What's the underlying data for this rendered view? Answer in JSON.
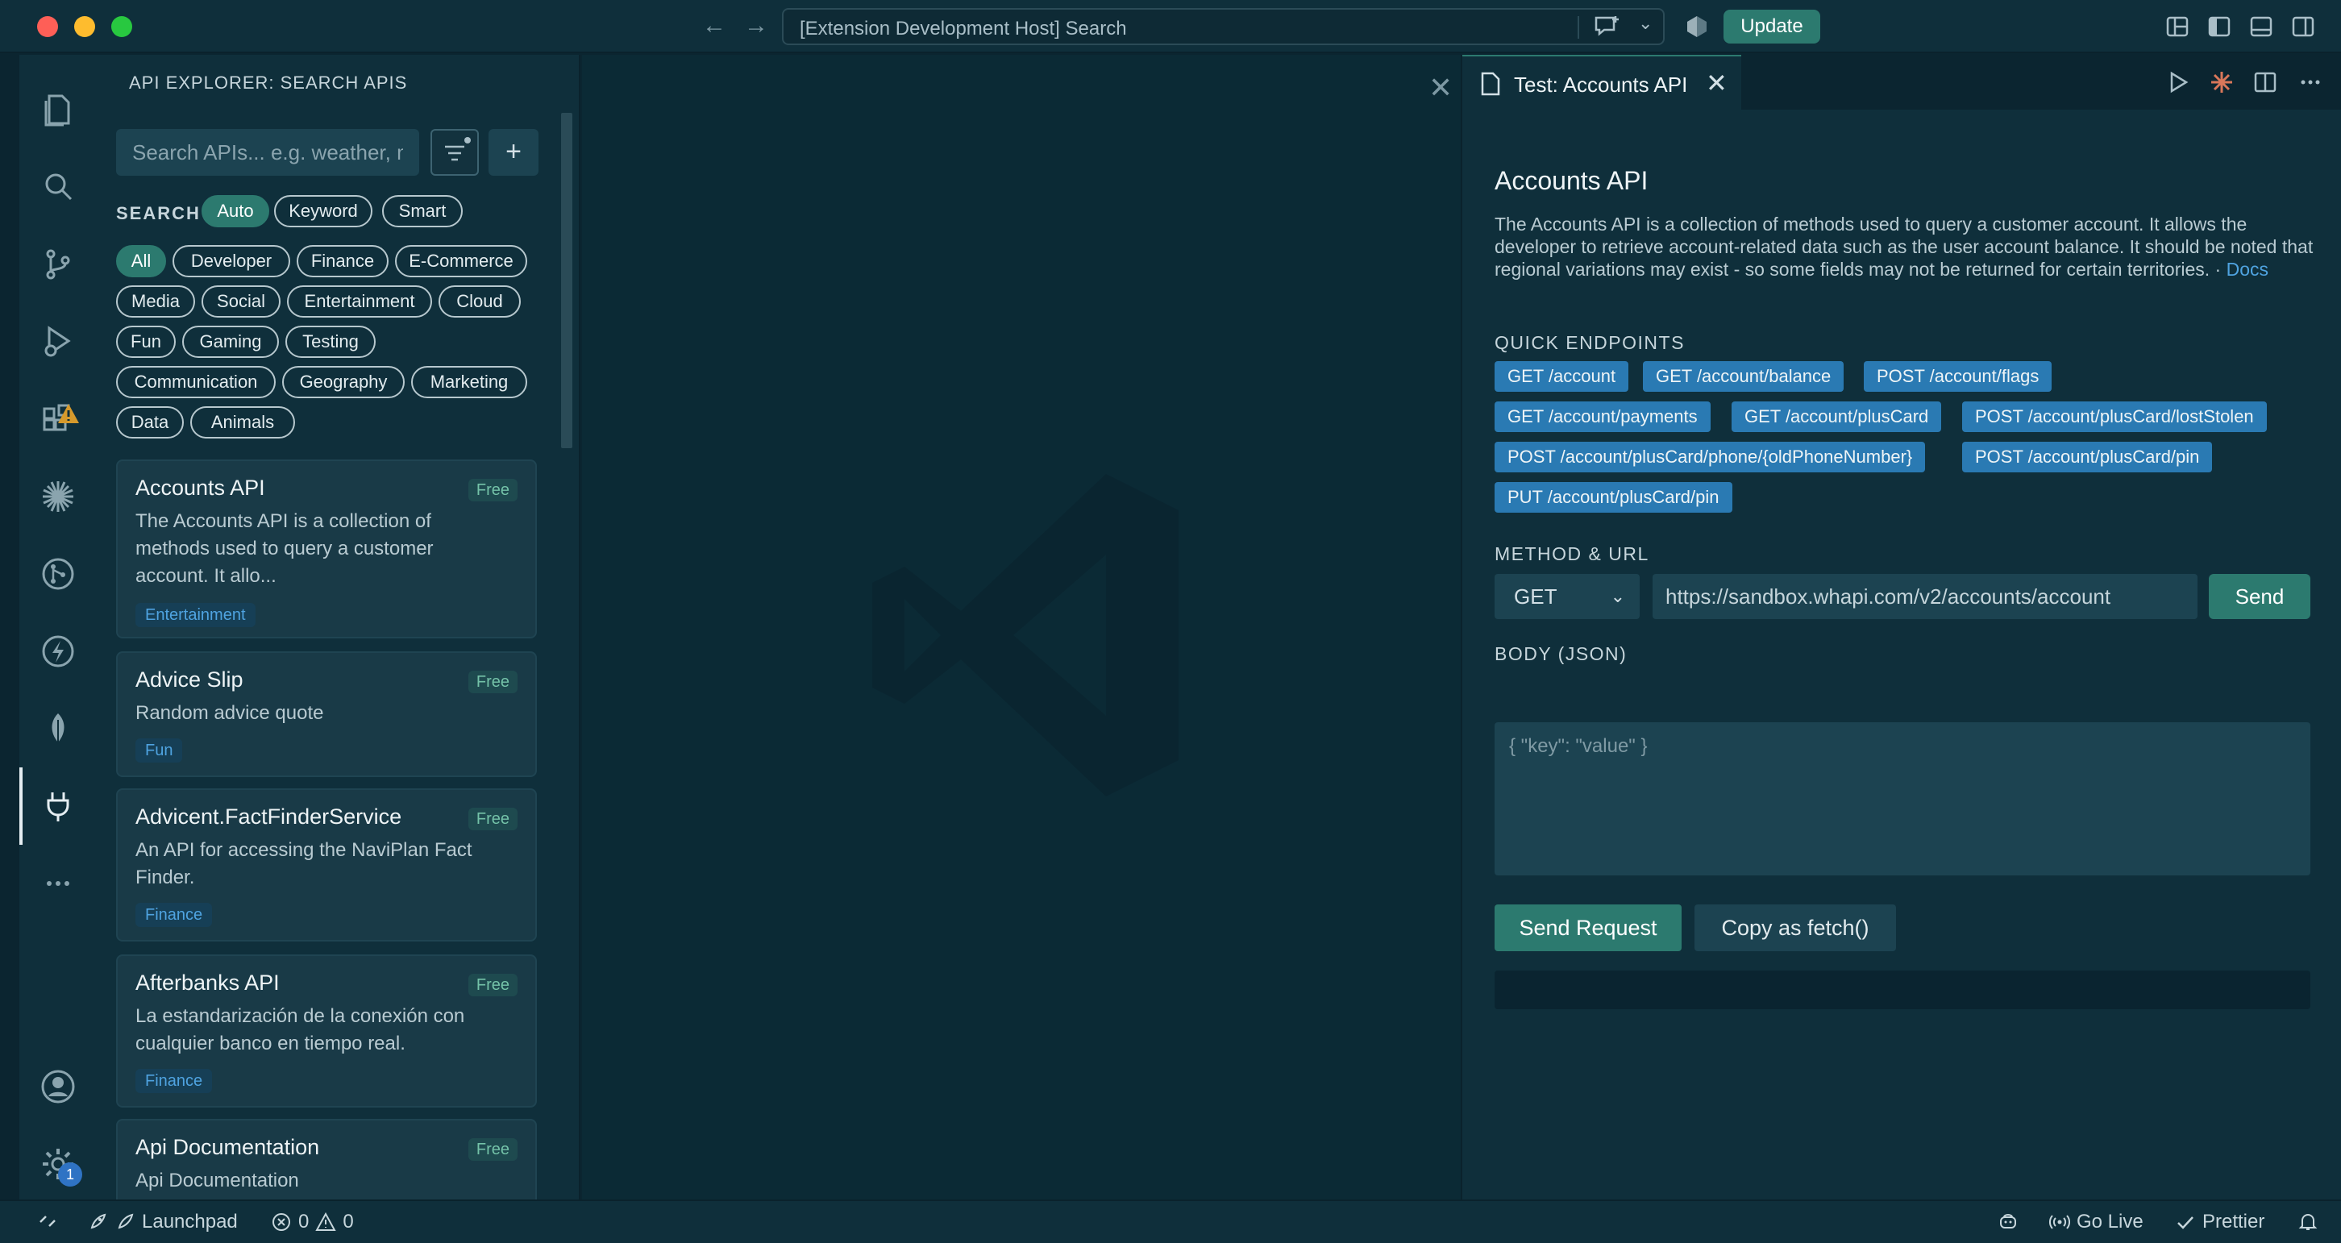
{
  "window": {
    "command_center_text": "[Extension Development Host] Search",
    "update_label": "Update"
  },
  "activity_bar": {
    "items": [
      "files-icon",
      "search-icon",
      "source-control-icon",
      "run-debug-icon",
      "extensions-icon",
      "star-burst-icon",
      "git-graph-icon",
      "lightning-icon",
      "leaf-icon",
      "plug-icon",
      "more-icon",
      "account-icon",
      "settings-icon"
    ],
    "settings_badge": "1"
  },
  "sidebar": {
    "title": "API EXPLORER: SEARCH APIS",
    "search_placeholder": "Search APIs... e.g. weather, maps",
    "add_label": "+",
    "search_label": "SEARCH",
    "modes": [
      "Auto",
      "Keyword",
      "Smart"
    ],
    "active_mode": "Auto",
    "categories": [
      "All",
      "Developer",
      "Finance",
      "E-Commerce",
      "Media",
      "Social",
      "Entertainment",
      "Cloud",
      "Fun",
      "Gaming",
      "Testing",
      "Communication",
      "Geography",
      "Marketing",
      "Data",
      "Animals"
    ],
    "active_category": "All",
    "results": [
      {
        "name": "Accounts API",
        "price": "Free",
        "description": "The Accounts API is a collection of methods used to query a customer account. It allo...",
        "tag": "Entertainment"
      },
      {
        "name": "Advice Slip",
        "price": "Free",
        "description": "Random advice quote",
        "tag": "Fun"
      },
      {
        "name": "Advicent.FactFinderService",
        "price": "Free",
        "description": "An API for accessing the NaviPlan Fact Finder.",
        "tag": "Finance"
      },
      {
        "name": "Afterbanks API",
        "price": "Free",
        "description": "La estandarización de la conexión con cualquier banco en tiempo real.",
        "tag": "Finance"
      },
      {
        "name": "Api Documentation",
        "price": "Free",
        "description": "Api Documentation",
        "tag": ""
      }
    ]
  },
  "editor": {
    "tab_label": "Test: Accounts API",
    "api_title": "Accounts API",
    "api_description": "The Accounts API is a collection of methods used to query a customer account. It allows the developer to retrieve account-related data such as the user account balance. It should be noted that regional variations may exist - so some fields may not be returned for certain territories. · ",
    "docs_link": "Docs",
    "quick_endpoints_label": "QUICK ENDPOINTS",
    "endpoints": [
      "GET /account",
      "GET /account/balance",
      "POST /account/flags",
      "GET /account/payments",
      "GET /account/plusCard",
      "POST /account/plusCard/lostStolen",
      "POST /account/plusCard/phone/{oldPhoneNumber}",
      "POST /account/plusCard/pin",
      "PUT /account/plusCard/pin"
    ],
    "method_url_label": "METHOD & URL",
    "method": "GET",
    "url": "https://sandbox.whapi.com/v2/accounts/account",
    "send_label": "Send",
    "body_label": "BODY (JSON)",
    "body_placeholder": "{ \"key\": \"value\" }",
    "send_request_label": "Send Request",
    "copy_fetch_label": "Copy as fetch()"
  },
  "statusbar": {
    "launchpad": "Launchpad",
    "errors": "0",
    "warnings": "0",
    "go_live": "Go Live",
    "prettier": "Prettier"
  },
  "colors": {
    "accent": "#2c7a6f",
    "endpoint_chip": "#2a7ab3",
    "link": "#4fa3e0",
    "background": "#0f2f3b"
  }
}
